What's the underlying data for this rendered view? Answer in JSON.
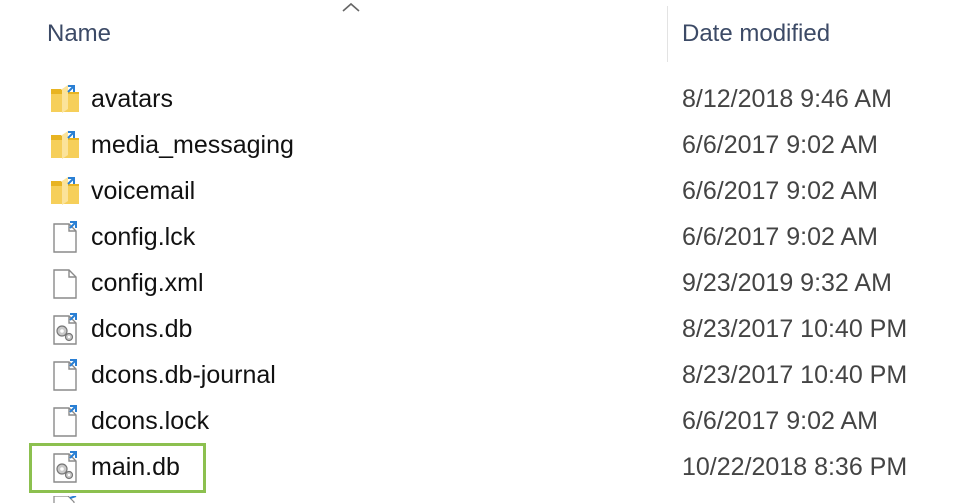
{
  "header": {
    "name_label": "Name",
    "date_label": "Date modified"
  },
  "files": [
    {
      "name": "avatars",
      "date": "8/12/2018 9:46 AM",
      "icon": "folder-icon"
    },
    {
      "name": "media_messaging",
      "date": "6/6/2017 9:02 AM",
      "icon": "folder-icon"
    },
    {
      "name": "voicemail",
      "date": "6/6/2017 9:02 AM",
      "icon": "folder-icon"
    },
    {
      "name": "config.lck",
      "date": "6/6/2017 9:02 AM",
      "icon": "file-icon"
    },
    {
      "name": "config.xml",
      "date": "9/23/2019 9:32 AM",
      "icon": "file-icon"
    },
    {
      "name": "dcons.db",
      "date": "8/23/2017 10:40 PM",
      "icon": "settings-file-icon"
    },
    {
      "name": "dcons.db-journal",
      "date": "8/23/2017 10:40 PM",
      "icon": "file-icon"
    },
    {
      "name": "dcons.lock",
      "date": "6/6/2017 9:02 AM",
      "icon": "file-icon"
    },
    {
      "name": "main.db",
      "date": "10/22/2018 8:36 PM",
      "icon": "settings-file-icon"
    }
  ],
  "colors": {
    "highlight": "#8cc04f",
    "folder": "#f4c542",
    "header_text": "#3c4a66"
  }
}
